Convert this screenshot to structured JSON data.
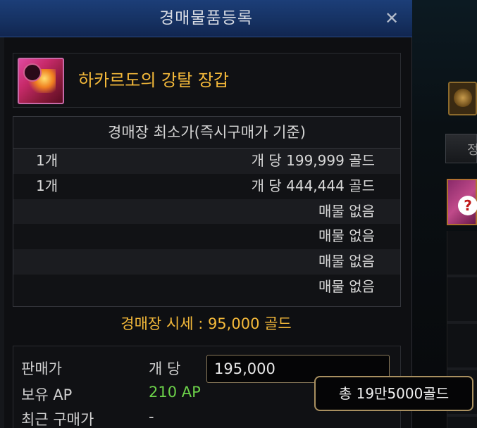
{
  "window": {
    "title": "경매물품등록",
    "close_label": "✕"
  },
  "item": {
    "name": "하카르도의 강탈 장갑"
  },
  "price_table": {
    "header": "경매장 최소가(즉시구매가 기준)",
    "rows": [
      {
        "qty": "1개",
        "price": "개 당 199,999 골드"
      },
      {
        "qty": "1개",
        "price": "개 당 444,444 골드"
      },
      {
        "qty": "",
        "price": "매물 없음"
      },
      {
        "qty": "",
        "price": "매물 없음"
      },
      {
        "qty": "",
        "price": "매물 없음"
      },
      {
        "qty": "",
        "price": "매물 없음"
      }
    ]
  },
  "market_price": "경매장 시세 : 95,000 골드",
  "sell": {
    "price_label": "판매가",
    "per_unit_label": "개 당",
    "price_value": "195,000",
    "ap_label": "보유 AP",
    "ap_value": "210 AP",
    "recent_label": "최근 구매가",
    "recent_value": "-"
  },
  "tooltip": {
    "total": "총 19만5000골드"
  },
  "colors": {
    "gold_text": "#f4b93a",
    "ap_green": "#6cd24a",
    "title_bar": "#163263"
  }
}
